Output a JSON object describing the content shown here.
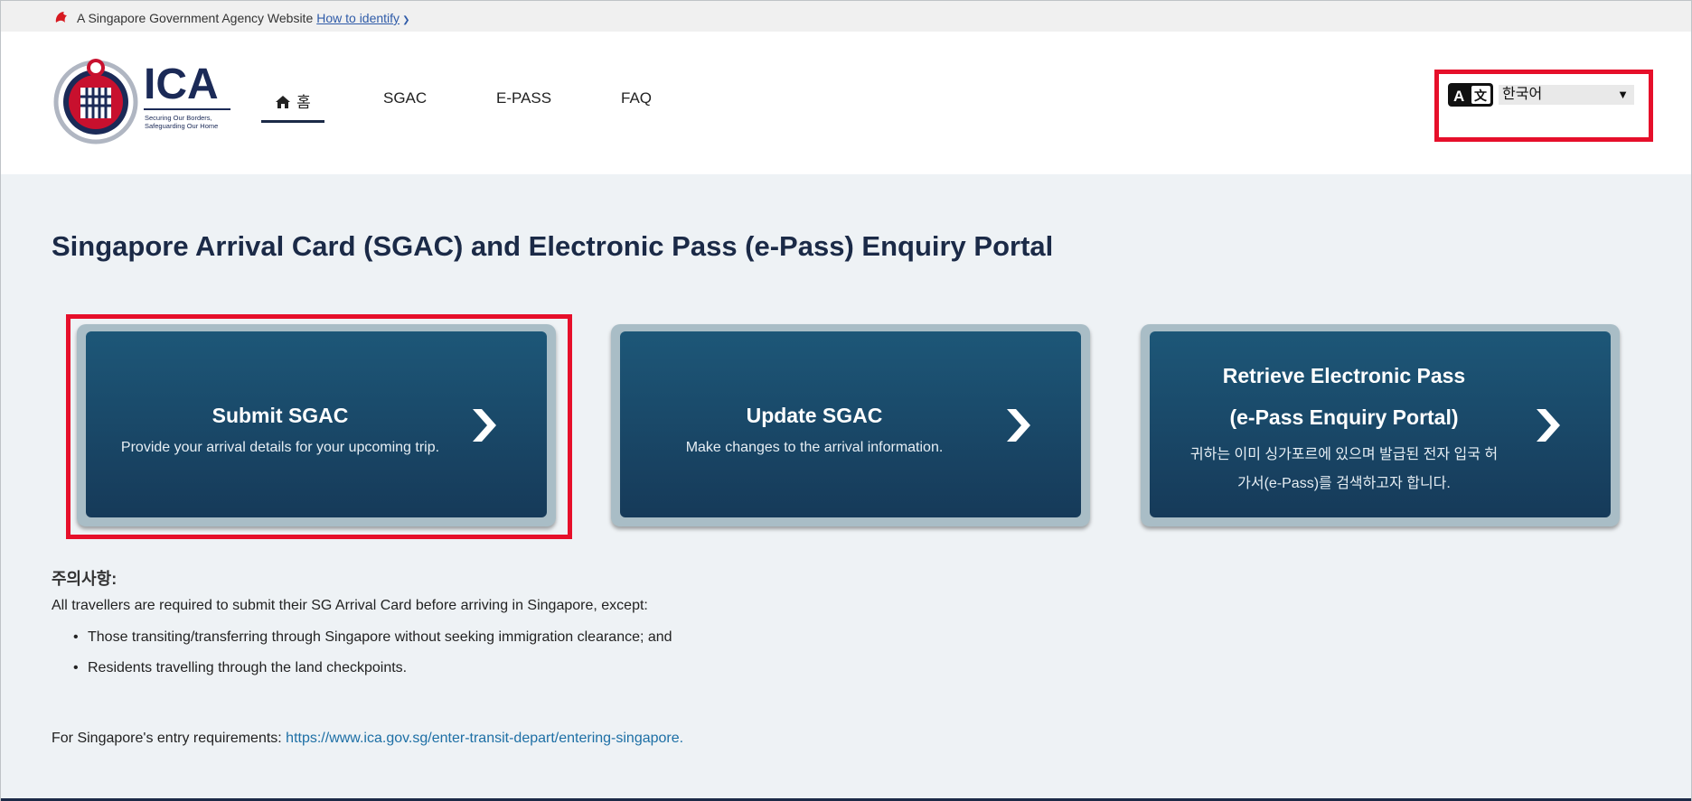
{
  "masthead": {
    "text": "A Singapore Government Agency Website",
    "link": "How to identify",
    "chevron_icon": "chevron-down-icon"
  },
  "logo": {
    "brand": "ICA",
    "tagline_line1": "Securing Our Borders,",
    "tagline_line2": "Safeguarding Our Home"
  },
  "nav": {
    "items": [
      {
        "label": "홈",
        "icon": "home-icon",
        "active": true
      },
      {
        "label": "SGAC"
      },
      {
        "label": "E-PASS"
      },
      {
        "label": "FAQ"
      }
    ]
  },
  "language": {
    "icon": "translate-icon",
    "selected": "한국어"
  },
  "main": {
    "title": "Singapore Arrival Card (SGAC) and Electronic Pass (e-Pass) Enquiry Portal",
    "cards": [
      {
        "title": "Submit SGAC",
        "desc": "Provide your arrival details for your upcoming trip."
      },
      {
        "title": "Update SGAC",
        "desc": "Make changes to the arrival information."
      },
      {
        "title_line1": "Retrieve Electronic Pass",
        "title_line2": "(e-Pass Enquiry Portal)",
        "desc_line1": "귀하는 이미 싱가포르에 있으며 발급된 전자 입국 허",
        "desc_line2": "가서(e-Pass)를 검색하고자 합니다."
      }
    ],
    "notes": {
      "title": "주의사항:",
      "text": "All travellers are required to submit their SG Arrival Card before arriving in Singapore, except:",
      "bullets": [
        "Those transiting/transferring through Singapore without seeking immigration clearance; and",
        "Residents travelling through the land checkpoints."
      ]
    },
    "entry": {
      "prefix": "For Singapore's entry requirements: ",
      "link": "https://www.ica.gov.sg/enter-transit-depart/entering-singapore."
    }
  },
  "colors": {
    "accent_red": "#e60f2a",
    "navy": "#1b2a47",
    "card_top": "#1d5778",
    "card_bottom": "#163a59",
    "link": "#1d6fa5"
  }
}
